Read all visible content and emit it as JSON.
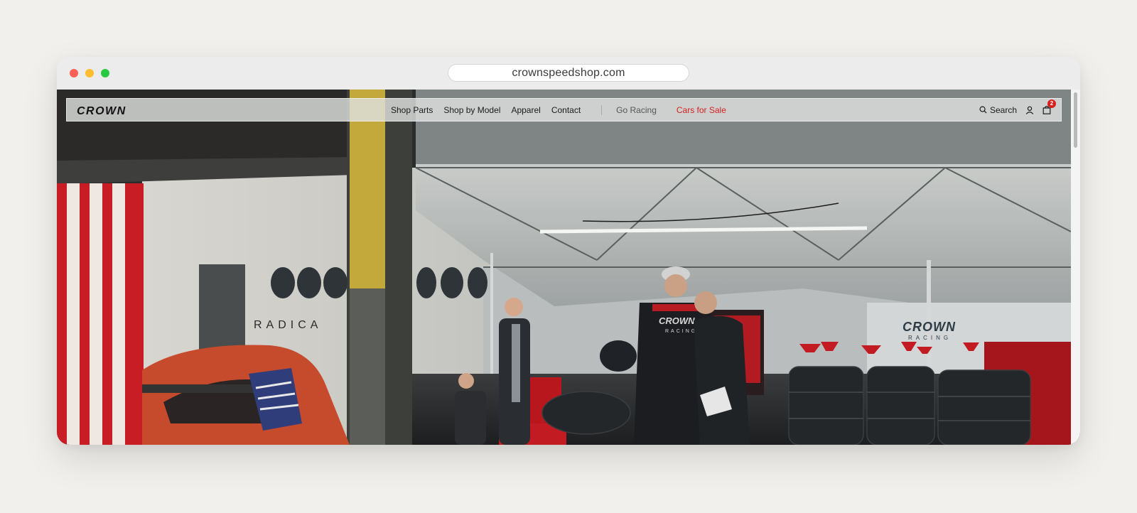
{
  "browser": {
    "url": "crownspeedshop.com"
  },
  "nav": {
    "brand_logo": "CROWN",
    "links": [
      {
        "label": "Shop Parts"
      },
      {
        "label": "Shop by Model"
      },
      {
        "label": "Apparel"
      },
      {
        "label": "Contact"
      }
    ],
    "secondary": {
      "go_racing": "Go Racing",
      "cars_for_sale": "Cars for Sale"
    },
    "search_label": "Search",
    "cart_count": "2",
    "accent_color": "#d6201f"
  },
  "hero": {
    "wall_lettering": "RADICA",
    "jersey_logo": "CROWN",
    "jersey_sub": "RACING",
    "trailer_logo": "CROWN",
    "trailer_sub": "RACING"
  }
}
